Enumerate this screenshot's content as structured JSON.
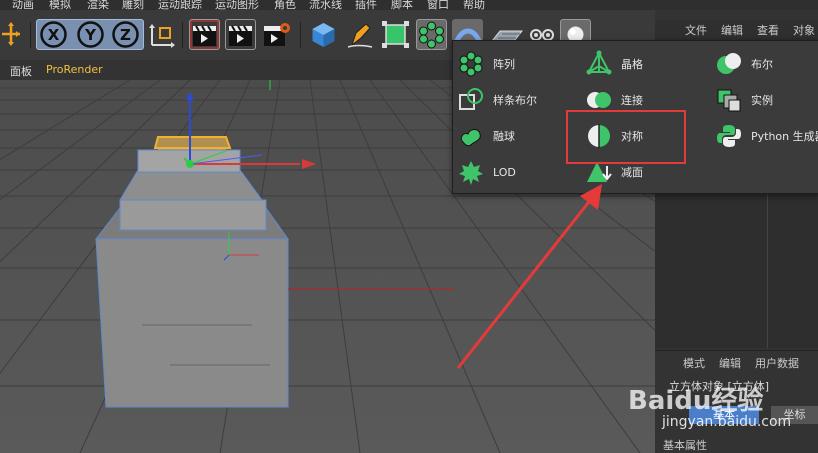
{
  "menubar": {
    "items": [
      "动画",
      "模拟",
      "渲染",
      "雕刻",
      "运动跟踪",
      "运动图形",
      "角色",
      "流水线",
      "插件",
      "脚本",
      "窗口",
      "帮助"
    ]
  },
  "toolbar": {
    "x_label": "X",
    "y_label": "Y",
    "z_label": "Z"
  },
  "modebar": {
    "panel_label": "面板",
    "prorender_label": "ProRender"
  },
  "object_manager": {
    "menu": [
      "文件",
      "编辑",
      "查看",
      "对象"
    ]
  },
  "popup": {
    "items": [
      {
        "label": "阵列",
        "icon": "array-icon"
      },
      {
        "label": "样条布尔",
        "icon": "spline-boolean-icon"
      },
      {
        "label": "融球",
        "icon": "metaball-icon"
      },
      {
        "label": "LOD",
        "icon": "lod-icon"
      },
      {
        "label": "晶格",
        "icon": "atom-array-icon"
      },
      {
        "label": "连接",
        "icon": "connect-icon"
      },
      {
        "label": "对称",
        "icon": "symmetry-icon"
      },
      {
        "label": "减面",
        "icon": "polygon-reduction-icon"
      },
      {
        "label": "布尔",
        "icon": "boole-icon"
      },
      {
        "label": "实例",
        "icon": "instance-icon"
      },
      {
        "label": "Python 生成器",
        "icon": "python-generator-icon"
      }
    ]
  },
  "attributes": {
    "menu": [
      "模式",
      "编辑",
      "用户数据"
    ],
    "object_title": "立方体对象 [立方体]",
    "tab_basic": "基本",
    "tab_coord": "坐标",
    "section": "基本属性"
  },
  "watermark": {
    "text": "Baidu经验",
    "url": "jingyan.baidu.com"
  },
  "colors": {
    "highlight_red": "#e53a3a",
    "accent_green": "#3fc46a",
    "popup_bg": "#3b3b3b",
    "viewport_bg": "#4a4a4a"
  }
}
